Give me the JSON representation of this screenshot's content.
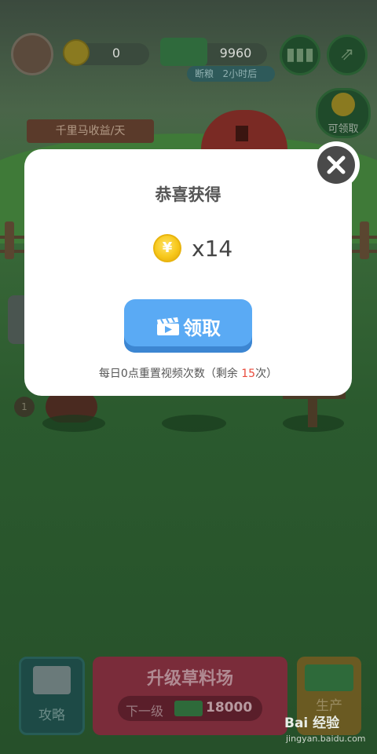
{
  "top_bar": {
    "coins": "0",
    "grass": "9960",
    "status_label": "断粮",
    "status_time": "2小时后"
  },
  "side_badge": {
    "label": "可领取"
  },
  "board": {
    "label": "千里马收益/天"
  },
  "level": {
    "value": "1"
  },
  "modal": {
    "title": "恭喜获得",
    "coin_symbol": "¥",
    "amount": "x14",
    "claim_label": "领取",
    "reset_prefix": "每日0点重置视频次数（剩余 ",
    "reset_remaining": "15",
    "reset_suffix": "次）"
  },
  "bottom": {
    "guide_label": "攻略",
    "upgrade_title": "升级草料场",
    "next_label": "下一级",
    "next_value": "18000",
    "produce_label": "生产"
  },
  "watermark": {
    "brand": "Bai 经验",
    "url": "jingyan.baidu.com"
  },
  "colors": {
    "claim_button": "#5aaaf4",
    "remaining_count": "#e94b3c",
    "coin": "#f7c81b"
  }
}
